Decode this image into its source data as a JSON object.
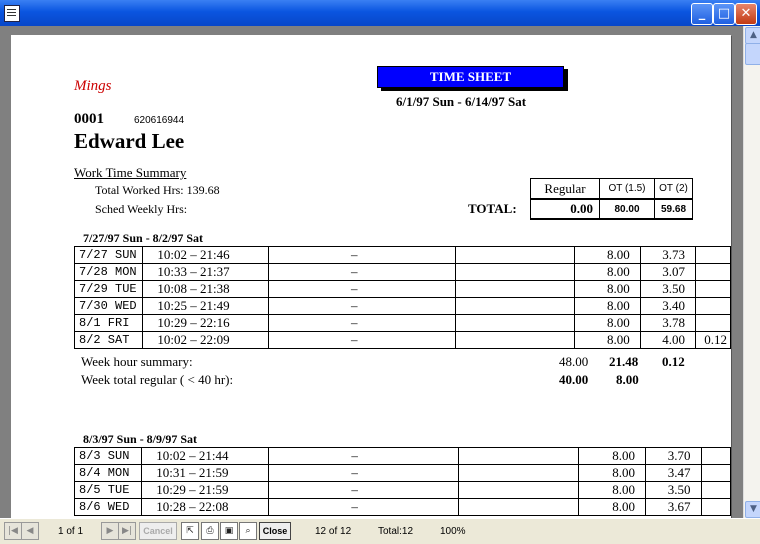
{
  "window": {
    "min_glyph": "_",
    "max_glyph": "□",
    "close_glyph": "✕"
  },
  "report": {
    "company": "Mings",
    "title": "TIME SHEET",
    "period": "6/1/97 Sun - 6/14/97  Sat",
    "employee_no": "0001",
    "employee_ssn": "620616944",
    "employee_name": "Edward Lee",
    "summary_heading": "Work Time Summary",
    "total_worked_label": "Total Worked  Hrs: 139.68",
    "sched_weekly_label": "Sched Weekly Hrs:",
    "total_label": "TOTAL:",
    "summary_headers": [
      "Regular",
      "OT (1.5)",
      "OT (2)"
    ],
    "summary_values": [
      "0.00",
      "80.00",
      "59.68"
    ]
  },
  "weeks": [
    {
      "title": "7/27/97  Sun - 8/2/97  Sat",
      "days": [
        {
          "date": "7/27 SUN",
          "time": "10:02 – 21:46",
          "dash": "–",
          "reg": "8.00",
          "ot15": "3.73",
          "ot2": ""
        },
        {
          "date": "7/28 MON",
          "time": "10:33 – 21:37",
          "dash": "–",
          "reg": "8.00",
          "ot15": "3.07",
          "ot2": ""
        },
        {
          "date": "7/29 TUE",
          "time": "10:08 – 21:38",
          "dash": "–",
          "reg": "8.00",
          "ot15": "3.50",
          "ot2": ""
        },
        {
          "date": "7/30 WED",
          "time": "10:25 – 21:49",
          "dash": "–",
          "reg": "8.00",
          "ot15": "3.40",
          "ot2": ""
        },
        {
          "date": "8/1  FRI",
          "time": "10:29 – 22:16",
          "dash": "–",
          "reg": "8.00",
          "ot15": "3.78",
          "ot2": ""
        },
        {
          "date": "8/2  SAT",
          "time": "10:02 – 22:09",
          "dash": "–",
          "reg": "8.00",
          "ot15": "4.00",
          "ot2": "0.12"
        }
      ],
      "summary_label": "Week hour summary:",
      "summary_reg": "48.00",
      "summary_ot15": "21.48",
      "summary_ot2": "0.12",
      "regular_label": "Week total regular ( < 40 hr):",
      "regular_reg": "40.00",
      "regular_ot15": "8.00"
    },
    {
      "title": "8/3/97  Sun - 8/9/97  Sat",
      "days": [
        {
          "date": "8/3  SUN",
          "time": "10:02 – 21:44",
          "dash": "–",
          "reg": "8.00",
          "ot15": "3.70",
          "ot2": ""
        },
        {
          "date": "8/4  MON",
          "time": "10:31 – 21:59",
          "dash": "–",
          "reg": "8.00",
          "ot15": "3.47",
          "ot2": ""
        },
        {
          "date": "8/5  TUE",
          "time": "10:29 – 21:59",
          "dash": "–",
          "reg": "8.00",
          "ot15": "3.50",
          "ot2": ""
        },
        {
          "date": "8/6  WED",
          "time": "10:28 – 22:08",
          "dash": "–",
          "reg": "8.00",
          "ot15": "3.67",
          "ot2": ""
        }
      ]
    }
  ],
  "statusbar": {
    "page_of": "1 of 1",
    "cancel": "Cancel",
    "close": "Close",
    "record": "12 of 12",
    "total": "Total:12",
    "zoom": "100%"
  }
}
